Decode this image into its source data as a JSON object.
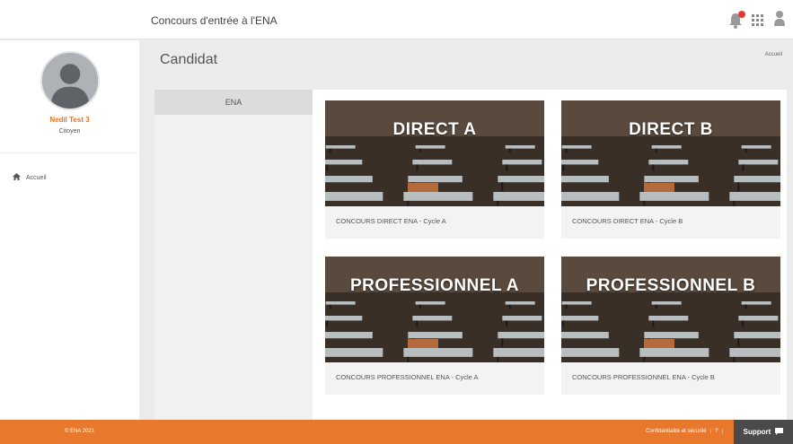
{
  "header": {
    "app_title": "Concours d'entrée à l'ENA",
    "notification_icon": "bell-icon",
    "apps_icon": "grid-icon",
    "user_icon": "user-icon"
  },
  "sidebar": {
    "user_name": "Nedil Test 3",
    "user_role": "Citoyen",
    "nav": [
      {
        "label": "Accueil",
        "icon": "home-icon"
      }
    ]
  },
  "page": {
    "title": "Candidat",
    "breadcrumb": "Accueil"
  },
  "tabs": [
    {
      "label": "ENA",
      "active": true
    }
  ],
  "cards": [
    {
      "heading": "DIRECT A",
      "caption": "CONCOURS DIRECT ENA - Cycle A"
    },
    {
      "heading": "DIRECT B",
      "caption": "CONCOURS DIRECT ENA - Cycle B"
    },
    {
      "heading": "PROFESSIONNEL A",
      "caption": "CONCOURS PROFESSIONNEL ENA - Cycle A"
    },
    {
      "heading": "PROFESSIONNEL B",
      "caption": "CONCOURS PROFESSIONNEL ENA - Cycle B"
    }
  ],
  "footer": {
    "copyright": "© ENA 2021",
    "links": [
      "Confidentialité et sécurité",
      "?"
    ],
    "support_label": "Support"
  },
  "colors": {
    "accent": "#e8782b",
    "support_bg": "#4a4a4a"
  }
}
